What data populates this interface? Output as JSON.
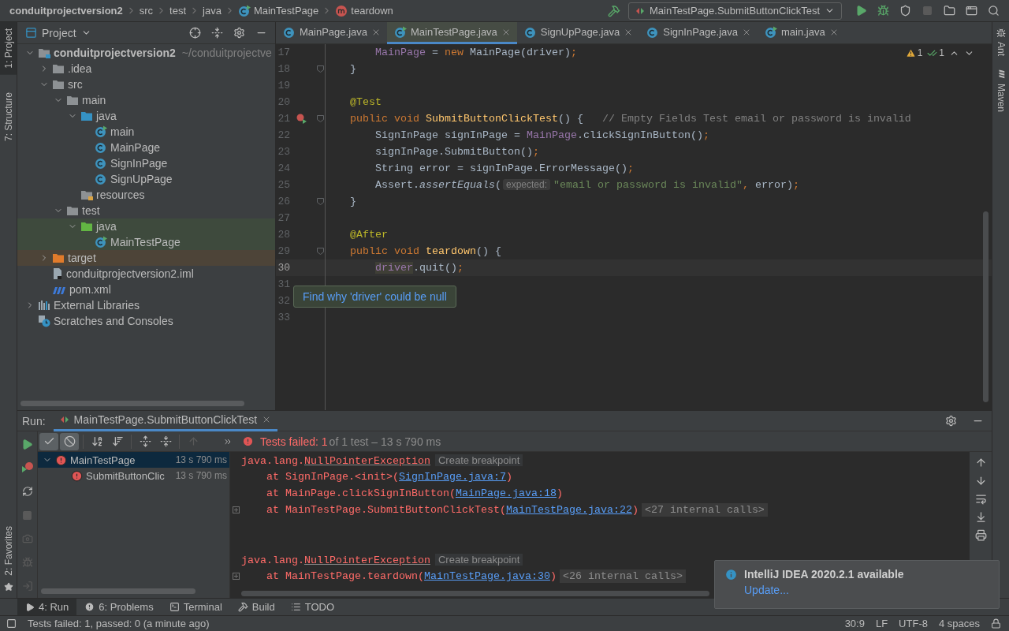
{
  "breadcrumbs": [
    {
      "label": "conduitprojectversion2",
      "kind": "project"
    },
    {
      "label": "src",
      "kind": "folder"
    },
    {
      "label": "test",
      "kind": "folder"
    },
    {
      "label": "java",
      "kind": "folder"
    },
    {
      "label": "MainTestPage",
      "kind": "class"
    },
    {
      "label": "teardown",
      "kind": "method"
    }
  ],
  "run_config": {
    "label": "MainTestPage.SubmitButtonClickTest"
  },
  "left_strip": [
    {
      "label": "1: Project",
      "selected": true
    },
    {
      "label": "7: Structure",
      "selected": false
    }
  ],
  "favorites": {
    "label": "2: Favorites"
  },
  "right_strip": [
    {
      "label": "Ant",
      "kind": "ant"
    },
    {
      "label": "Maven",
      "kind": "maven"
    }
  ],
  "project": {
    "title": "Project",
    "tree": [
      {
        "label": "conduitprojectversion2",
        "path": "~/conduitprojectve",
        "kind": "module",
        "expanded": true,
        "children": [
          {
            "label": ".idea",
            "kind": "folder",
            "expanded": false
          },
          {
            "label": "src",
            "kind": "folder",
            "expanded": true,
            "children": [
              {
                "label": "main",
                "kind": "folder",
                "expanded": true,
                "children": [
                  {
                    "label": "java",
                    "kind": "source",
                    "expanded": true,
                    "children": [
                      {
                        "label": "main",
                        "kind": "main_class"
                      },
                      {
                        "label": "MainPage",
                        "kind": "class"
                      },
                      {
                        "label": "SignInPage",
                        "kind": "class"
                      },
                      {
                        "label": "SignUpPage",
                        "kind": "class"
                      }
                    ]
                  },
                  {
                    "label": "resources",
                    "kind": "resources"
                  }
                ]
              },
              {
                "label": "test",
                "kind": "folder",
                "expanded": true,
                "children": [
                  {
                    "label": "java",
                    "kind": "test_source",
                    "expanded": true,
                    "color": "#3e4a3d",
                    "children": [
                      {
                        "label": "MainTestPage",
                        "kind": "test_class",
                        "color": "#3e4a3d"
                      }
                    ]
                  }
                ]
              }
            ]
          },
          {
            "label": "target",
            "kind": "excluded",
            "expanded": false,
            "color": "#4d4438"
          },
          {
            "label": "conduitprojectversion2.iml",
            "kind": "iml"
          },
          {
            "label": "pom.xml",
            "kind": "maven"
          }
        ]
      },
      {
        "label": "External Libraries",
        "kind": "libraries",
        "expanded": false
      },
      {
        "label": "Scratches and Consoles",
        "kind": "scratches"
      }
    ]
  },
  "editor": {
    "tabs": [
      {
        "label": "MainPage.java",
        "kind": "class",
        "selected": false
      },
      {
        "label": "MainTestPage.java",
        "kind": "test_class",
        "selected": true
      },
      {
        "label": "SignUpPage.java",
        "kind": "class",
        "selected": false
      },
      {
        "label": "SignInPage.java",
        "kind": "class",
        "selected": false
      },
      {
        "label": "main.java",
        "kind": "main_class",
        "selected": false
      }
    ],
    "inspections": {
      "warnings": "1",
      "weak_warnings": "1"
    },
    "lines": [
      {
        "number": "17",
        "tokens": [
          {
            "kind": "field",
            "text": "        MainPage"
          },
          {
            "kind": "plain",
            "text": " = "
          },
          {
            "kind": "kw",
            "text": "new"
          },
          {
            "kind": "plain",
            "text": " MainPage(driver)"
          },
          {
            "kind": "kw",
            "text": ";"
          }
        ]
      },
      {
        "number": "18",
        "fold": true,
        "tokens": [
          {
            "kind": "plain",
            "text": "    }"
          }
        ]
      },
      {
        "number": "19"
      },
      {
        "number": "20",
        "tokens": [
          {
            "kind": "ann",
            "text": "    @Test"
          }
        ]
      },
      {
        "number": "21",
        "fold": true,
        "run_marker": true,
        "tokens": [
          {
            "kind": "kw",
            "text": "    public void "
          },
          {
            "kind": "fn",
            "text": "SubmitButtonClickTest"
          },
          {
            "kind": "plain",
            "text": "() {   "
          },
          {
            "kind": "comment",
            "text": "// Empty Fields Test email or password is invalid"
          }
        ]
      },
      {
        "number": "22",
        "tokens": [
          {
            "kind": "plain",
            "text": "        SignInPage signInPage = "
          },
          {
            "kind": "field",
            "text": "MainPage"
          },
          {
            "kind": "plain",
            "text": ".clickSignInButton()"
          },
          {
            "kind": "kw",
            "text": ";"
          }
        ]
      },
      {
        "number": "23",
        "tokens": [
          {
            "kind": "plain",
            "text": "        signInPage.SubmitButton()"
          },
          {
            "kind": "kw",
            "text": ";"
          }
        ]
      },
      {
        "number": "24",
        "tokens": [
          {
            "kind": "plain",
            "text": "        String error = signInPage.ErrorMessage()"
          },
          {
            "kind": "kw",
            "text": ";"
          }
        ]
      },
      {
        "number": "25",
        "tokens": [
          {
            "kind": "plain",
            "text": "        Assert."
          },
          {
            "kind": "italic",
            "text": "assertEquals"
          },
          {
            "kind": "plain",
            "text": "("
          },
          {
            "kind": "hint",
            "text": "expected:"
          },
          {
            "kind": "str",
            "text": "\"email or password is invalid\""
          },
          {
            "kind": "kw",
            "text": ","
          },
          {
            "kind": "plain",
            "text": " error)"
          },
          {
            "kind": "kw",
            "text": ";"
          }
        ]
      },
      {
        "number": "26",
        "fold": true,
        "tokens": [
          {
            "kind": "plain",
            "text": "    }"
          }
        ]
      },
      {
        "number": "27"
      },
      {
        "number": "28",
        "tokens": [
          {
            "kind": "ann",
            "text": "    @After"
          }
        ]
      },
      {
        "number": "29",
        "fold": true,
        "tokens": [
          {
            "kind": "kw",
            "text": "    public void "
          },
          {
            "kind": "fn",
            "text": "teardown"
          },
          {
            "kind": "plain",
            "text": "() {"
          }
        ]
      },
      {
        "number": "30",
        "current": true,
        "tokens": [
          {
            "kind": "warn",
            "text": "        driver"
          },
          {
            "kind": "plain",
            "text": ".quit()"
          },
          {
            "kind": "kw",
            "text": ";"
          }
        ]
      },
      {
        "number": "31"
      },
      {
        "number": "32"
      },
      {
        "number": "33"
      }
    ],
    "tooltip": {
      "text": "Find why 'driver' could be null"
    }
  },
  "run": {
    "label": "Run:",
    "tab": "MainTestPage.SubmitButtonClickTest",
    "toggles": [
      {
        "kind": "show_passed",
        "selected": true
      },
      {
        "kind": "show_ignored",
        "selected": true
      }
    ],
    "status_failed": "Tests failed: 1",
    "status_rest": "of 1 test – 13 s 790 ms",
    "tests": [
      {
        "label": "MainTestPage",
        "time": "13 s 790 ms",
        "failed": true,
        "expanded": true,
        "selected": true,
        "children": [
          {
            "label": "SubmitButtonClic",
            "time": "13 s 790 ms",
            "failed": true,
            "selected": false
          }
        ]
      }
    ],
    "console": [
      {
        "lines": [
          {
            "fold": false,
            "tokens": [
              {
                "kind": "err",
                "text": "java.lang."
              },
              {
                "kind": "exc",
                "text": "NullPointerException"
              },
              {
                "kind": "hint",
                "text": "Create breakpoint"
              }
            ]
          },
          {
            "fold": false,
            "tokens": [
              {
                "kind": "err",
                "text": "    at SignInPage.<init>("
              },
              {
                "kind": "link",
                "text": "SignInPage.java:7"
              },
              {
                "kind": "err",
                "text": ")"
              }
            ]
          },
          {
            "fold": false,
            "tokens": [
              {
                "kind": "err",
                "text": "    at MainPage.clickSignInButton("
              },
              {
                "kind": "link",
                "text": "MainPage.java:18"
              },
              {
                "kind": "err",
                "text": ")"
              }
            ]
          },
          {
            "fold": true,
            "tokens": [
              {
                "kind": "err",
                "text": "    at MainTestPage.SubmitButtonClickTest("
              },
              {
                "kind": "link",
                "text": "MainTestPage.java:22"
              },
              {
                "kind": "err",
                "text": ")"
              },
              {
                "kind": "calls",
                "text": "<27 internal calls>"
              }
            ]
          }
        ]
      },
      {
        "lines": [
          {
            "fold": false,
            "tokens": [
              {
                "kind": "err",
                "text": "java.lang."
              },
              {
                "kind": "exc",
                "text": "NullPointerException"
              },
              {
                "kind": "hint",
                "text": "Create breakpoint"
              }
            ]
          },
          {
            "fold": true,
            "tokens": [
              {
                "kind": "err",
                "text": "    at MainTestPage.teardown("
              },
              {
                "kind": "link",
                "text": "MainTestPage.java:30"
              },
              {
                "kind": "err",
                "text": ")"
              },
              {
                "kind": "calls",
                "text": "<26 internal calls>"
              }
            ]
          }
        ]
      }
    ]
  },
  "bottom_tabs": [
    {
      "label": "4: Run",
      "kind": "run",
      "selected": true
    },
    {
      "label": "6: Problems",
      "kind": "problems",
      "selected": false
    },
    {
      "label": "Terminal",
      "kind": "terminal",
      "selected": false
    },
    {
      "label": "Build",
      "kind": "build",
      "selected": false
    },
    {
      "label": "TODO",
      "kind": "todo",
      "selected": false
    }
  ],
  "notification": {
    "title": "IntelliJ IDEA 2020.2.1 available",
    "action": "Update..."
  },
  "status_bar": {
    "message": "Tests failed: 1, passed: 0 (a minute ago)",
    "position": "30:9",
    "line_separator": "LF",
    "encoding": "UTF-8",
    "indent": "4 spaces"
  }
}
